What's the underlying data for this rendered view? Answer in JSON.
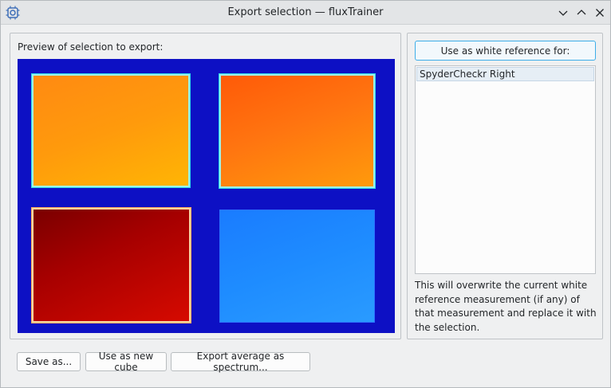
{
  "window": {
    "title": "Export selection — fluxTrainer",
    "app_icon": "chip-gear-icon",
    "controls": [
      "chevron-down-icon",
      "chevron-up-icon",
      "close-icon"
    ]
  },
  "preview": {
    "label": "Preview of selection to export:"
  },
  "white_reference": {
    "button_label": "Use as white reference for:",
    "items": [
      "SpyderCheckr Right"
    ],
    "note": "This will overwrite the current white reference measurement (if any) of that measurement and replace it with the selection."
  },
  "footer": {
    "save_label": "Save as...",
    "new_cube_label": "Use as new cube",
    "export_average_label": "Export average as spectrum..."
  },
  "colors": {
    "accent": "#3daee9",
    "preview_background": "#0d10c4"
  }
}
